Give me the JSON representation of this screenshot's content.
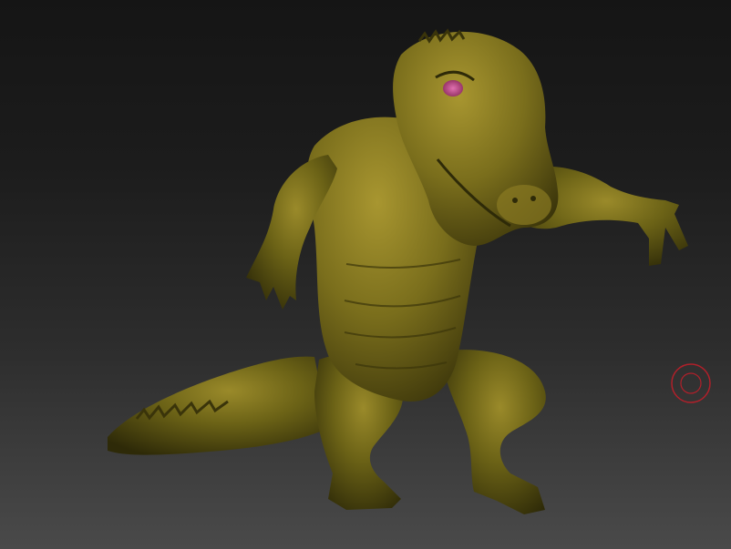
{
  "viewport": {
    "background_top": "#151515",
    "background_bottom": "#4a4a4a"
  },
  "model": {
    "icon": "crocodile-sculpt",
    "skin_color": "#6b6216",
    "skin_highlight": "#9a8a2a",
    "skin_shadow": "#2e2a08",
    "eye_color": "#c04a8a"
  },
  "brush_cursor": {
    "icon": "brush-circle-icon",
    "color": "#b0202a"
  }
}
